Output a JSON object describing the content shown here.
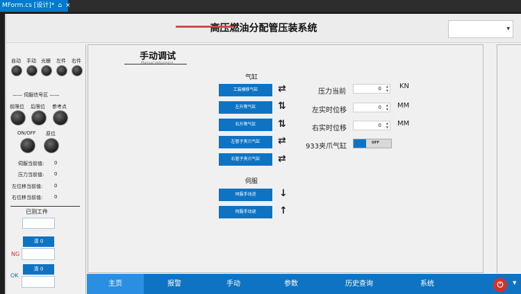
{
  "ide_tab": {
    "label": "MForm.cs [设计]*",
    "pin": "⌂",
    "close": "×"
  },
  "header": {
    "title": "高压燃油分配管压装系统"
  },
  "status_lamps": [
    {
      "label": "自动"
    },
    {
      "label": "手动"
    },
    {
      "label": "光栅"
    },
    {
      "label": "左件"
    },
    {
      "label": "右件"
    }
  ],
  "servo_signals": {
    "section_label": "—— 伺服信号区 ——",
    "lamps": [
      {
        "label": "前限位"
      },
      {
        "label": "后限位"
      },
      {
        "label": "参考点"
      }
    ],
    "lamps2": [
      {
        "label": "ON/OFF"
      },
      {
        "label": "原位"
      }
    ],
    "readouts": [
      {
        "label": "伺服当前值:",
        "value": "0"
      },
      {
        "label": "压力当前值:",
        "value": "0"
      },
      {
        "label": "左位移当前值:",
        "value": "0"
      },
      {
        "label": "右位移当前值:",
        "value": "0"
      }
    ]
  },
  "work_count": {
    "section_label": "已测工件",
    "clear_ng_label": "清 0",
    "ng_label": "NG",
    "clear_ok_label": "清 0",
    "ok_label": "OK"
  },
  "manual": {
    "heading": "手动调试",
    "subheading": "Manual debugging",
    "cylinder_group_label": "气缸",
    "cylinder_buttons": [
      {
        "label": "工装横移气缸",
        "glyph": "⇄"
      },
      {
        "label": "左升降气缸",
        "glyph": "⇅"
      },
      {
        "label": "右升降气缸",
        "glyph": "⇅"
      },
      {
        "label": "左管子夹爪气缸",
        "glyph": "⇄"
      },
      {
        "label": "右管子夹爪气缸",
        "glyph": "⇄"
      }
    ],
    "servo_group_label": "伺服",
    "servo_buttons": [
      {
        "label": "伺服手动进",
        "glyph": "↓"
      },
      {
        "label": "伺服手动退",
        "glyph": "↑"
      }
    ],
    "readings": [
      {
        "label": "压力当前",
        "value": "0",
        "unit": "KN"
      },
      {
        "label": "左实时位移",
        "value": "0",
        "unit": "MM"
      },
      {
        "label": "右实时位移",
        "value": "0",
        "unit": "MM"
      }
    ],
    "clamp": {
      "label": "933夹爪气缸",
      "state": "OFF"
    }
  },
  "nav": {
    "items": [
      {
        "label": "主页"
      },
      {
        "label": "报警"
      },
      {
        "label": "手动"
      },
      {
        "label": "参数"
      },
      {
        "label": "历史查询"
      },
      {
        "label": "系统"
      }
    ],
    "active_index": 0,
    "power_glyph": "⏻",
    "caret": "▼"
  },
  "colors": {
    "accent": "#0f73c4",
    "power": "#d73027",
    "title_accent": "#c8504a"
  }
}
